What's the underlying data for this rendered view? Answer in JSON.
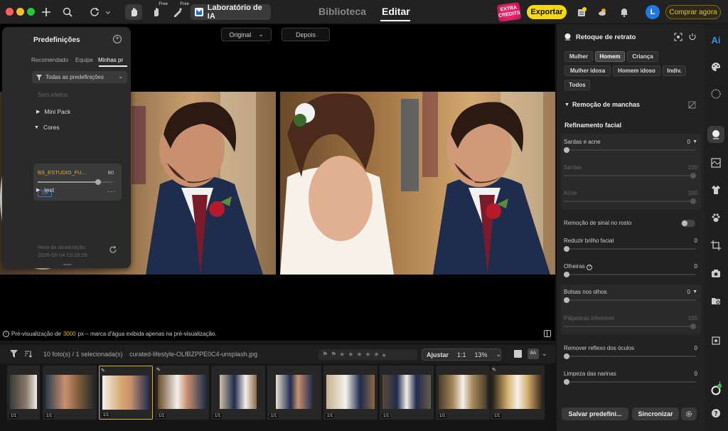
{
  "titlebar": {
    "hand_free_label": "Free",
    "stamp_free_label": "Free",
    "lab_label": "Laboratório de IA",
    "tab_library": "Biblioteca",
    "tab_edit": "Editar",
    "extra_credits_label": "EXTRA CREDITS",
    "export_label": "Exportar",
    "notification_badge": "1",
    "avatar_initial": "L",
    "buy_label": "Comprar agora"
  },
  "presets": {
    "title": "Predefinições",
    "tabs": [
      "Recomendado",
      "Equipe",
      "Minhas pr"
    ],
    "filter_label": "Todas as predefinições",
    "no_effects": "Sem efeitos",
    "groups": [
      "Mini Pack",
      "Cores",
      "test"
    ],
    "card": {
      "name": "BS_ESTUDIO_FU...",
      "value": "80",
      "level": 0.8,
      "badge": "Cor"
    },
    "update_label": "Hora da atualização:",
    "update_time": "2026-06-04 10:18:29"
  },
  "canvas": {
    "original_label": "Original",
    "after_label": "Depois",
    "note_prefix": "Pré-visualização de ",
    "note_highlight": "3000",
    "note_suffix": "px – marca d'água exibida apenas na pré-visualização."
  },
  "film": {
    "count_label": "10 foto(s) / 1 selecionada(s)",
    "file_name": "curated-lifestyle-OLfBZPPE0C4-unsplash.jpg",
    "adjust_label": "Ajustar",
    "ratio_label": "1:1",
    "zoom_label": "13%",
    "thumb_tag": "1/1"
  },
  "right": {
    "title": "Retoque de retrato",
    "chips": [
      "Mulher",
      "Homem",
      "Criança",
      "Mulher idosa",
      "Homem idoso",
      "Indiv.",
      "Todos"
    ],
    "blemish_section": "Remoção de manchas",
    "facial_section": "Refinamento facial",
    "freckles": {
      "label": "Sardas e acne",
      "value": "0"
    },
    "sardas": {
      "label": "Sardas",
      "value": "100"
    },
    "acne": {
      "label": "Acne",
      "value": "100"
    },
    "mole_removal": "Remoção de sinal no rosto",
    "reduce_shine": {
      "label": "Reduzir brilho facial",
      "value": "0"
    },
    "dark_circles": {
      "label": "Olheiras",
      "value": "0"
    },
    "eye_bags": {
      "label": "Bolsas nos olhos",
      "value": "0"
    },
    "lower_lids": {
      "label": "Pálpebras inferiores",
      "value": "100"
    },
    "glasses_reflection": {
      "label": "Remover reflexo dos óculos",
      "value": "0"
    },
    "nostrils": {
      "label": "Limpeza das narinas",
      "value": "0"
    },
    "save_preset": "Salvar predefini...",
    "sync": "Sincronizar"
  },
  "rtool": {
    "ai_label": "Ai",
    "badge": "1"
  },
  "colors": {
    "accent_yellow": "#f5d90a",
    "accent_blue": "#1e7ae0",
    "selected_border": "#d6b32a"
  }
}
